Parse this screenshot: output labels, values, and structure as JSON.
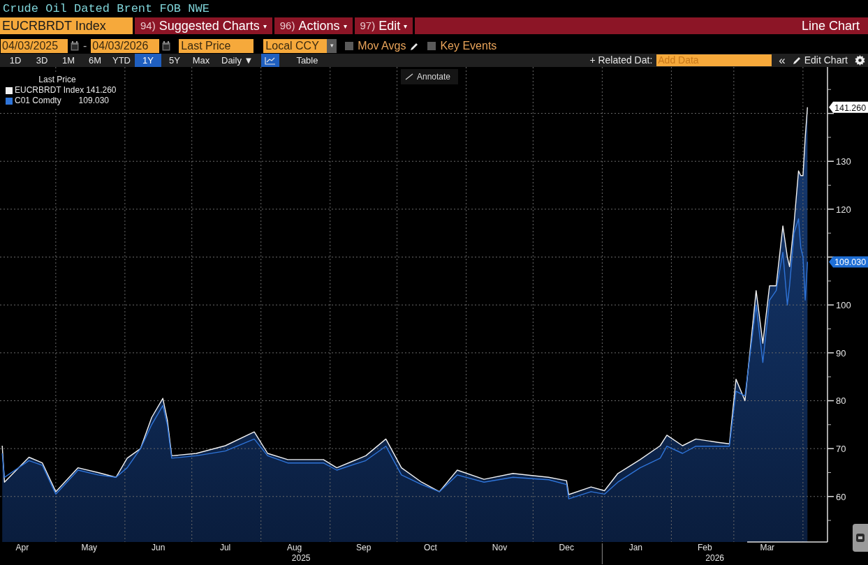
{
  "title": "Crude Oil Dated Brent FOB NWE",
  "toolbar": {
    "ticker": "EUCRBRDT Index",
    "menus": [
      {
        "number": "94)",
        "label": "Suggested Charts",
        "caret": "▾"
      },
      {
        "number": "96)",
        "label": "Actions",
        "caret": "▾"
      },
      {
        "number": "97)",
        "label": "Edit",
        "caret": "▾"
      }
    ],
    "view": "Line Chart"
  },
  "controls": {
    "start_date": "04/03/2025",
    "separator": "-",
    "end_date": "04/03/2026",
    "field": "Last Price",
    "currency": "Local CCY",
    "currency_caret": "▾",
    "checkboxes": [
      {
        "label": "Mov Avgs",
        "checked": false,
        "kind": "editable"
      },
      {
        "label": "Key Events",
        "checked": false,
        "kind": "plain"
      }
    ]
  },
  "range_bar": {
    "ranges": [
      {
        "label": "1D",
        "selected": false
      },
      {
        "label": "3D",
        "selected": false
      },
      {
        "label": "1M",
        "selected": false
      },
      {
        "label": "6M",
        "selected": false
      },
      {
        "label": "YTD",
        "selected": false
      },
      {
        "label": "1Y",
        "selected": true
      },
      {
        "label": "5Y",
        "selected": false
      },
      {
        "label": "Max",
        "selected": false
      }
    ],
    "frequency": "Daily ▼",
    "views": [
      {
        "kind": "icon",
        "selected": true
      },
      {
        "kind": "text",
        "label": "Table",
        "selected": false
      }
    ],
    "related": "+ Related Dat:",
    "add_data_placeholder": "Add Data",
    "collapse": "«",
    "edit_chart": "Edit Chart"
  },
  "chart": {
    "annotate": "Annotate",
    "legend": {
      "title": "Last Price",
      "values": [
        "141.260",
        "109.030"
      ]
    },
    "badges": [
      "141.260",
      "109.030"
    ],
    "year_labels": [
      "2025",
      "2026"
    ],
    "chart_data": {
      "type": "line",
      "grid": true,
      "xlim": [
        "2025-04-06",
        "2026-04-12"
      ],
      "ylim": [
        50.5,
        149.7
      ],
      "xticks": [
        {
          "value": "2025-04-16",
          "label": "Apr"
        },
        {
          "value": "2025-05-16",
          "label": "May"
        },
        {
          "value": "2025-06-16",
          "label": "Jun"
        },
        {
          "value": "2025-07-16",
          "label": "Jul"
        },
        {
          "value": "2025-08-16",
          "label": "Aug"
        },
        {
          "value": "2025-09-16",
          "label": "Sep"
        },
        {
          "value": "2025-10-16",
          "label": "Oct"
        },
        {
          "value": "2025-11-16",
          "label": "Nov"
        },
        {
          "value": "2025-12-16",
          "label": "Dec"
        },
        {
          "value": "2026-01-16",
          "label": "Jan"
        },
        {
          "value": "2026-02-16",
          "label": "Feb"
        },
        {
          "value": "2026-03-16",
          "label": "Mar"
        }
      ],
      "yticks": [
        60,
        70,
        80,
        90,
        100,
        120,
        130
      ],
      "x": [
        "2025-04-07",
        "2025-04-08",
        "2025-04-19",
        "2025-04-25",
        "2025-05-01",
        "2025-05-11",
        "2025-05-20",
        "2025-05-28",
        "2025-06-02",
        "2025-06-08",
        "2025-06-13",
        "2025-06-18",
        "2025-06-20",
        "2025-06-22",
        "2025-07-03",
        "2025-07-16",
        "2025-07-29",
        "2025-08-04",
        "2025-08-13",
        "2025-08-29",
        "2025-09-04",
        "2025-09-17",
        "2025-09-26",
        "2025-10-03",
        "2025-10-12",
        "2025-10-20",
        "2025-10-28",
        "2025-11-09",
        "2025-11-22",
        "2025-12-08",
        "2025-12-16",
        "2025-12-17",
        "2025-12-27",
        "2026-01-02",
        "2026-01-08",
        "2026-01-18",
        "2026-01-27",
        "2026-01-30",
        "2026-02-06",
        "2026-02-12",
        "2026-02-22",
        "2026-02-27",
        "2026-03-02",
        "2026-03-06",
        "2026-03-11",
        "2026-03-14",
        "2026-03-17",
        "2026-03-20",
        "2026-03-23",
        "2026-03-25",
        "2026-03-26",
        "2026-03-28",
        "2026-03-30",
        "2026-03-31",
        "2026-04-01",
        "2026-04-02",
        "2026-04-03"
      ],
      "series": [
        {
          "name": "EUCRBRDT Index",
          "color": "#f2f2f2",
          "type": "area",
          "values": [
            70.6,
            63,
            68.2,
            67,
            61,
            66,
            65,
            64,
            68,
            70,
            76.5,
            80.5,
            76,
            68.5,
            69,
            70.6,
            73.5,
            69,
            67.7,
            67.7,
            66,
            68.5,
            72,
            66,
            63,
            61,
            65.5,
            63.6,
            64.8,
            64,
            63.3,
            60.4,
            62,
            61.2,
            64.8,
            67.7,
            70.6,
            72.8,
            70.6,
            72,
            71.3,
            71,
            84.5,
            80,
            103,
            92,
            104,
            104,
            116.5,
            110,
            108,
            117,
            128,
            127,
            127,
            135,
            141.3
          ]
        },
        {
          "name": "C01 Comdty",
          "color": "#2f74d8",
          "values": [
            69,
            64,
            67.5,
            66.5,
            60.5,
            65.5,
            64.5,
            64,
            66,
            70,
            75,
            79,
            75,
            68,
            68.5,
            69.5,
            72,
            68.5,
            67,
            67,
            65.5,
            67.5,
            70.5,
            64.5,
            62.5,
            61,
            64.5,
            63,
            64,
            63.5,
            62.5,
            59.5,
            61,
            60.5,
            63,
            66,
            68,
            70.5,
            69,
            70.5,
            70.5,
            70.5,
            82,
            81,
            100,
            88,
            101,
            103,
            111,
            100,
            104,
            115,
            118,
            112,
            110,
            101,
            109
          ]
        }
      ]
    }
  }
}
